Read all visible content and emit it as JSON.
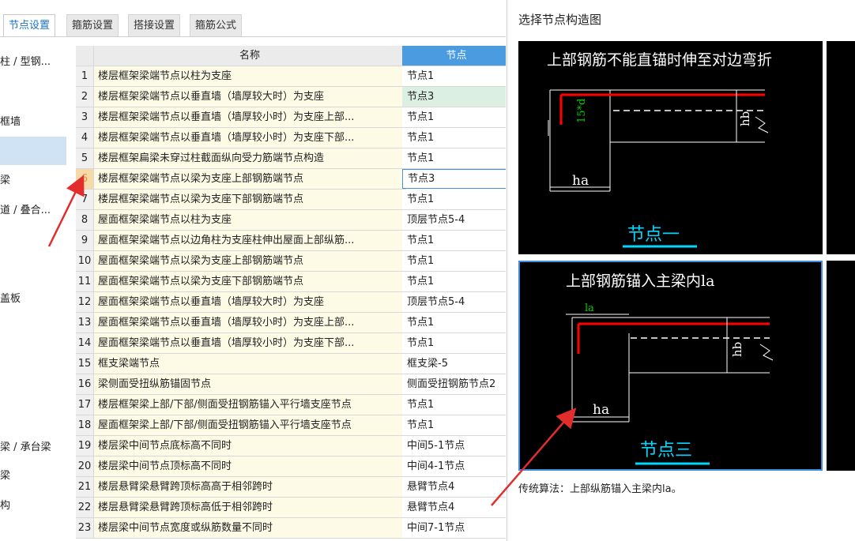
{
  "tabs": [
    {
      "label": "节点设置"
    },
    {
      "label": "箍筋设置"
    },
    {
      "label": "搭接设置"
    },
    {
      "label": "箍筋公式"
    }
  ],
  "tree": [
    {
      "label": "柱 / 型钢..."
    },
    {
      "label": "框墙"
    },
    {
      "label": ""
    },
    {
      "label": "梁"
    },
    {
      "label": "道 / 叠合..."
    },
    {
      "label": "盖板"
    },
    {
      "label": "梁 / 承台梁"
    },
    {
      "label": "梁"
    },
    {
      "label": "构"
    }
  ],
  "grid": {
    "header_name": "名称",
    "header_node": "节点",
    "rows": [
      {
        "num": "1",
        "name": "楼层框架梁端节点以柱为支座",
        "node": "节点1"
      },
      {
        "num": "2",
        "name": "楼层框架梁端节点以垂直墙（墙厚较大时）为支座",
        "node": "节点3"
      },
      {
        "num": "3",
        "name": "楼层框架梁端节点以垂直墙（墙厚较小时）为支座上部...",
        "node": "节点1"
      },
      {
        "num": "4",
        "name": "楼层框架梁端节点以垂直墙（墙厚较小时）为支座下部...",
        "node": "节点1"
      },
      {
        "num": "5",
        "name": "楼层框架扁梁未穿过柱截面纵向受力筋端节点构造",
        "node": "节点1"
      },
      {
        "num": "6",
        "name": "楼层框架梁端节点以梁为支座上部钢筋端节点",
        "node": "节点3"
      },
      {
        "num": "7",
        "name": "楼层框架梁端节点以梁为支座下部钢筋端节点",
        "node": "节点1"
      },
      {
        "num": "8",
        "name": "屋面框架梁端节点以柱为支座",
        "node": "顶层节点5-4"
      },
      {
        "num": "9",
        "name": "屋面框架梁端节点以边角柱为支座柱伸出屋面上部纵筋...",
        "node": "节点1"
      },
      {
        "num": "10",
        "name": "屋面框架梁端节点以梁为支座上部钢筋端节点",
        "node": "节点1"
      },
      {
        "num": "11",
        "name": "屋面框架梁端节点以梁为支座下部钢筋端节点",
        "node": "节点1"
      },
      {
        "num": "12",
        "name": "屋面框架梁端节点以垂直墙（墙厚较大时）为支座",
        "node": "顶层节点5-4"
      },
      {
        "num": "13",
        "name": "屋面框架梁端节点以垂直墙（墙厚较小时）为支座上部...",
        "node": "节点1"
      },
      {
        "num": "14",
        "name": "屋面框架梁端节点以垂直墙（墙厚较小时）为支座下部...",
        "node": "节点1"
      },
      {
        "num": "15",
        "name": "框支梁端节点",
        "node": "框支梁-5"
      },
      {
        "num": "16",
        "name": "梁侧面受扭纵筋锚固节点",
        "node": "侧面受扭钢筋节点2"
      },
      {
        "num": "17",
        "name": "楼层框架梁上部/下部/侧面受扭钢筋锚入平行墙支座节点",
        "node": "节点1"
      },
      {
        "num": "18",
        "name": "屋面框架梁上部/下部/侧面受扭钢筋锚入平行墙支座节点",
        "node": "节点1"
      },
      {
        "num": "19",
        "name": "楼层梁中间节点底标高不同时",
        "node": "中间5-1节点"
      },
      {
        "num": "20",
        "name": "楼层梁中间节点顶标高不同时",
        "node": "中间4-1节点"
      },
      {
        "num": "21",
        "name": "楼层悬臂梁悬臂跨顶标高高于相邻跨时",
        "node": "悬臂节点4"
      },
      {
        "num": "22",
        "name": "楼层悬臂梁悬臂跨顶标高低于相邻跨时",
        "node": "悬臂节点4"
      },
      {
        "num": "23",
        "name": "楼层梁中间节点宽度或纵筋数量不同时",
        "node": "中间7-1节点"
      }
    ]
  },
  "panel": {
    "title": "选择节点构造图",
    "description": "传统算法：上部纵筋锚入主梁内la。",
    "images": [
      {
        "heading": "上部钢筋不能直锚时伸至对边弯折",
        "caption": "节点一",
        "dim_left": "15*d",
        "dim_bottom": "ha",
        "dim_right": "hb"
      },
      {
        "heading": "上部钢筋锚入主梁内la",
        "caption": "节点三",
        "dim_top": "la",
        "dim_bottom": "ha",
        "dim_right": "hb"
      }
    ]
  },
  "colors": {
    "accent": "#1a73c9",
    "header_blue": "#4a9be0",
    "rebar_red": "#ff0000",
    "caption_cyan": "#00d7ff",
    "arrow_red": "#e32c2c"
  }
}
